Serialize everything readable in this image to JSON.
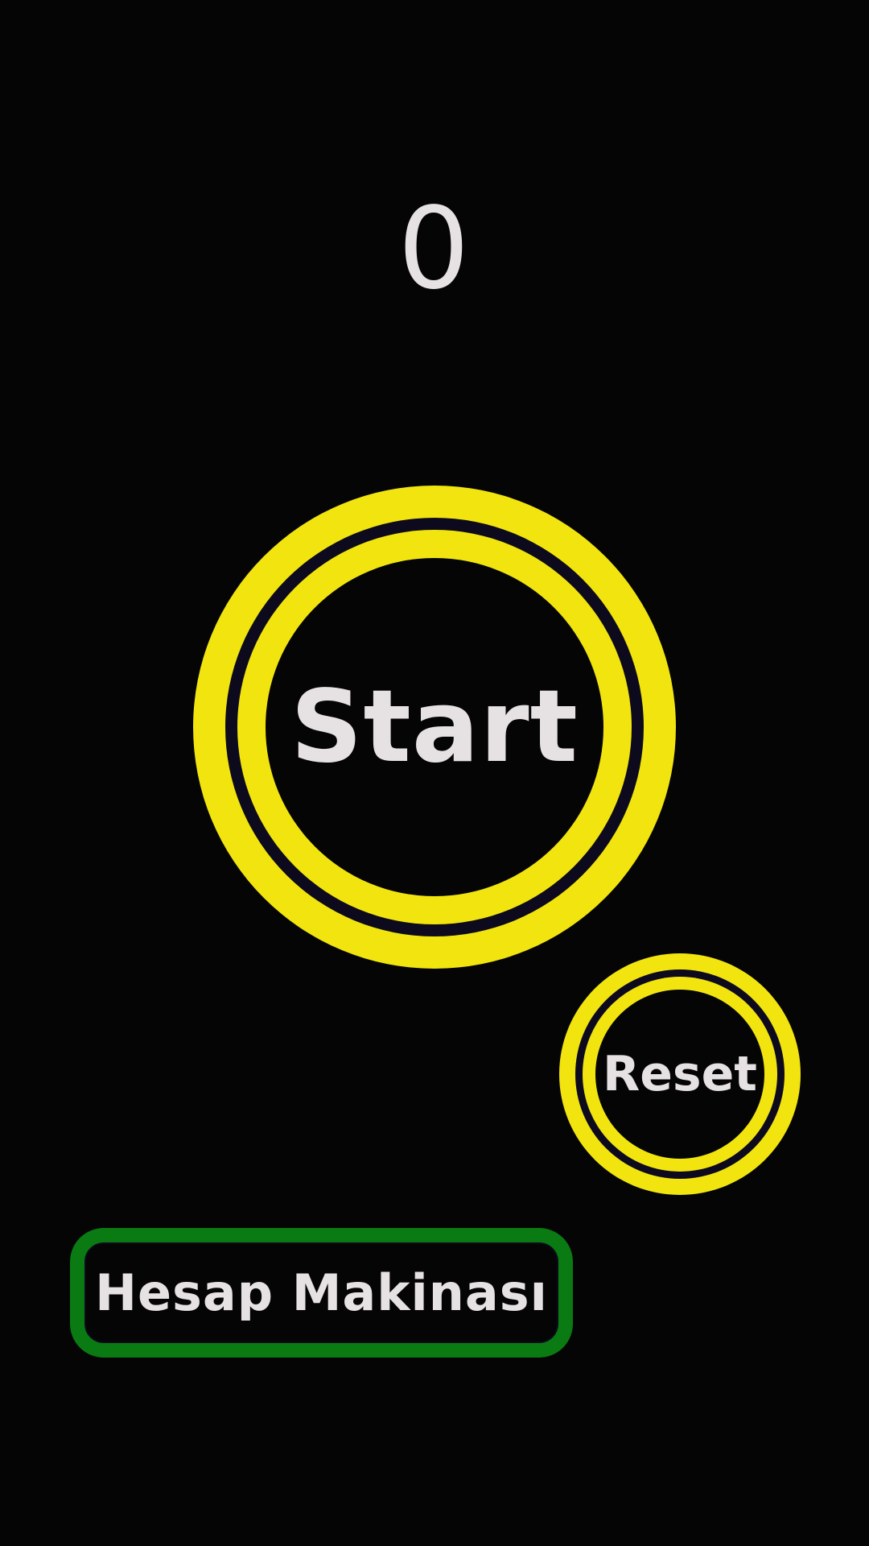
{
  "counter": {
    "value": "0"
  },
  "start_button": {
    "label": "Start"
  },
  "reset_button": {
    "label": "Reset"
  },
  "calculator_button": {
    "label": "Hesap Makinası"
  },
  "colors": {
    "background": "#050505",
    "ring_yellow": "#f2e50f",
    "ring_gap": "#0c0a1c",
    "button_green": "#0a7a12",
    "text": "#e6e1e2"
  }
}
